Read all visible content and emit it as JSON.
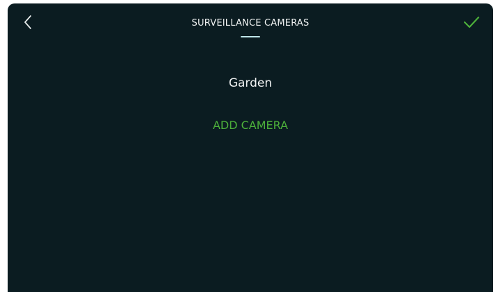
{
  "header": {
    "title": "SURVEILLANCE CAMERAS",
    "back_icon": "chevron-left-icon",
    "confirm_icon": "checkmark-icon"
  },
  "cameras": [
    {
      "label": "Garden"
    }
  ],
  "add_camera_label": "ADD CAMERA",
  "colors": {
    "background": "#0b1c21",
    "accent_green": "#4caf3a",
    "text": "#f2f4f4",
    "title_underline": "#bfe6ea"
  }
}
